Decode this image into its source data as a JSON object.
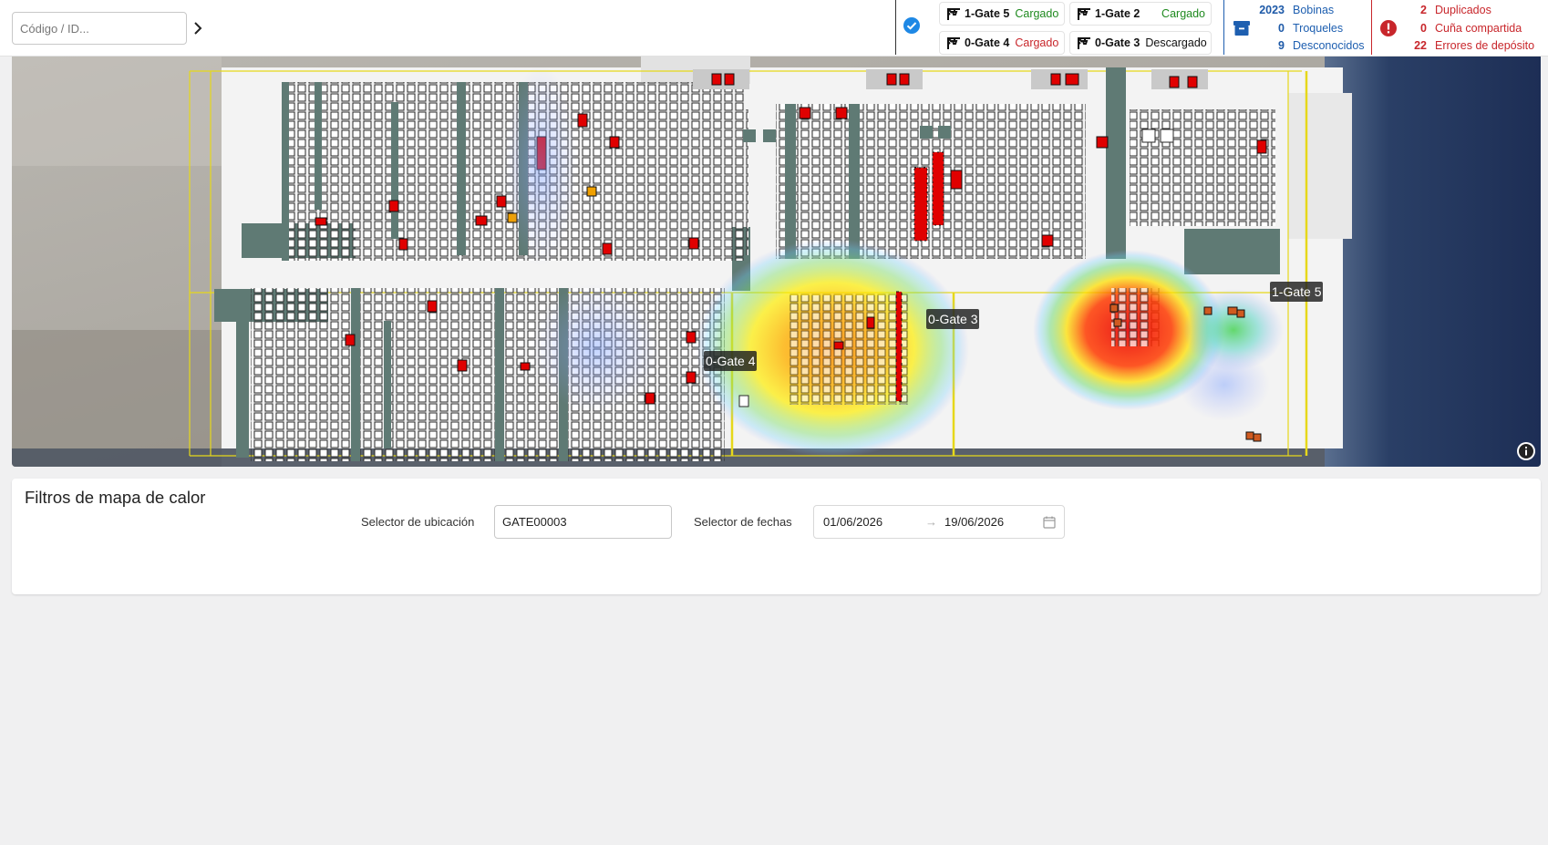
{
  "search": {
    "placeholder": "Código / ID..."
  },
  "gates": [
    {
      "name": "1-Gate 5",
      "status": "Cargado",
      "status_color": "#1f8a1f"
    },
    {
      "name": "1-Gate 2",
      "status": "Cargado",
      "status_color": "#1f8a1f"
    },
    {
      "name": "0-Gate 4",
      "status": "Cargado",
      "status_color": "#c8262b"
    },
    {
      "name": "0-Gate 3",
      "status": "Descargado",
      "status_color": "#111111"
    }
  ],
  "inventory_stats": [
    {
      "value": "2023",
      "label": "Bobinas"
    },
    {
      "value": "0",
      "label": "Troqueles"
    },
    {
      "value": "9",
      "label": "Desconocidos"
    }
  ],
  "error_stats": [
    {
      "value": "2",
      "label": "Duplicados"
    },
    {
      "value": "0",
      "label": "Cuña compartida"
    },
    {
      "value": "22",
      "label": "Errores de depósito"
    }
  ],
  "map": {
    "gate_labels": [
      "1-Gate 5",
      "0-Gate 3",
      "0-Gate 4"
    ]
  },
  "filters": {
    "title": "Filtros de mapa de calor",
    "location_label": "Selector de ubicación",
    "location_value": "GATE00003",
    "date_label": "Selector de fechas",
    "date_from": "01/06/2026",
    "date_arrow": "→",
    "date_to": "19/06/2026"
  },
  "colors": {
    "accent_blue": "#1e88e5",
    "stat_blue": "#1e5fb0",
    "error_red": "#c8262b",
    "ok_green": "#1f8a1f"
  },
  "icons": [
    "chevron-right-icon",
    "check-circle-icon",
    "crane-icon",
    "archive-icon",
    "alert-circle-icon",
    "info-icon",
    "calendar-icon"
  ]
}
